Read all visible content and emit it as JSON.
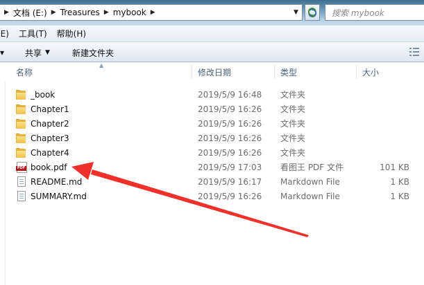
{
  "address": {
    "crumbs": [
      "文档 (E:)",
      "Treasures",
      "mybook"
    ],
    "search_placeholder": "搜索 mybook"
  },
  "menu": {
    "items": [
      "(E)",
      "工具(T)",
      "帮助(H)"
    ]
  },
  "toolbar": {
    "share_label": "共享",
    "new_folder_label": "新建文件夹"
  },
  "columns": {
    "name": "名称",
    "date": "修改日期",
    "type": "类型",
    "size": "大小"
  },
  "files": [
    {
      "name": "_book",
      "date": "2019/5/9 16:48",
      "type": "文件夹",
      "size": "",
      "icon": "folder-icon"
    },
    {
      "name": "Chapter1",
      "date": "2019/5/9 16:26",
      "type": "文件夹",
      "size": "",
      "icon": "folder-icon"
    },
    {
      "name": "Chapter2",
      "date": "2019/5/9 16:26",
      "type": "文件夹",
      "size": "",
      "icon": "folder-icon"
    },
    {
      "name": "Chapter3",
      "date": "2019/5/9 16:26",
      "type": "文件夹",
      "size": "",
      "icon": "folder-icon"
    },
    {
      "name": "Chapter4",
      "date": "2019/5/9 16:26",
      "type": "文件夹",
      "size": "",
      "icon": "folder-icon"
    },
    {
      "name": "book.pdf",
      "date": "2019/5/9 17:03",
      "type": "看图王 PDF 文件",
      "size": "101 KB",
      "icon": "pdf-file-icon"
    },
    {
      "name": "README.md",
      "date": "2019/5/9 16:17",
      "type": "Markdown File",
      "size": "1 KB",
      "icon": "markdown-file-icon"
    },
    {
      "name": "SUMMARY.md",
      "date": "2019/5/9 16:26",
      "type": "Markdown File",
      "size": "1 KB",
      "icon": "markdown-file-icon"
    }
  ],
  "annotation": {
    "color": "#f0302a",
    "icon": "red-arrow-pointing-to-book-pdf"
  }
}
